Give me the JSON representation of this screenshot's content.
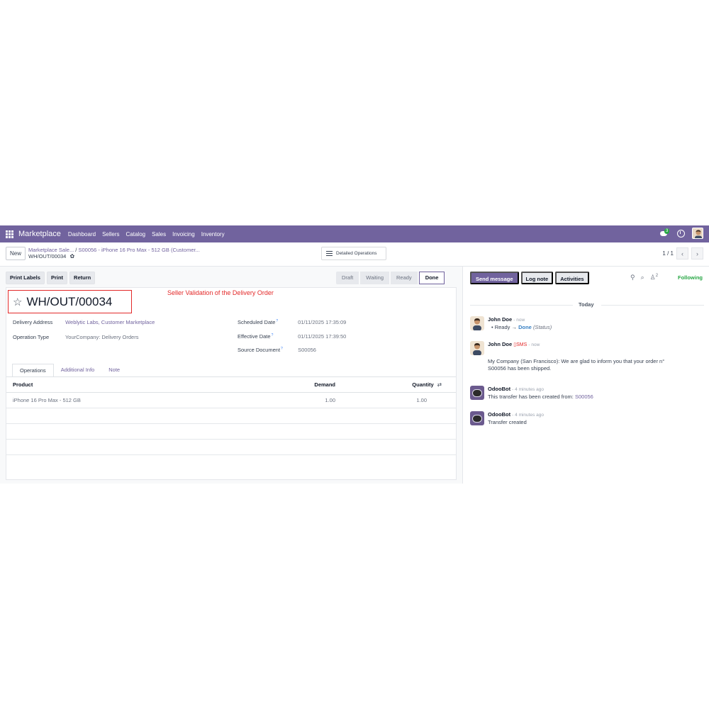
{
  "navbar": {
    "app_name": "Marketplace",
    "menu": [
      "Dashboard",
      "Sellers",
      "Catalog",
      "Sales",
      "Invoicing",
      "Inventory"
    ],
    "chat_badge": "3"
  },
  "control": {
    "new_label": "New",
    "breadcrumb_parent": "Marketplace Sale...",
    "breadcrumb_sep": "/",
    "breadcrumb_order": "S00056 - iPhone 16 Pro Max - 512 GB (Customer...",
    "breadcrumb_current": "WH/OUT/00034",
    "detailed_operations": "Detailed Operations",
    "pager": "1 / 1"
  },
  "actions": [
    "Print Labels",
    "Print",
    "Return"
  ],
  "statusbar": {
    "stages": [
      "Draft",
      "Waiting",
      "Ready",
      "Done"
    ],
    "current": "Done"
  },
  "form": {
    "title": "WH/OUT/00034",
    "annotation": "Seller Validation of the Delivery Order",
    "delivery_address_label": "Delivery Address",
    "delivery_address": "Weblytic Labs, Customer Marketplace",
    "operation_type_label": "Operation Type",
    "operation_type": "YourCompany: Delivery Orders",
    "scheduled_date_label": "Scheduled Date",
    "scheduled_date": "01/11/2025 17:35:09",
    "effective_date_label": "Effective Date",
    "effective_date": "01/11/2025 17:39:50",
    "source_document_label": "Source Document",
    "source_document": "S00056",
    "help_mark": "?"
  },
  "tabs": [
    "Operations",
    "Additional Info",
    "Note"
  ],
  "operations": {
    "headers": {
      "product": "Product",
      "demand": "Demand",
      "quantity": "Quantity"
    },
    "rows": [
      {
        "product": "iPhone 16 Pro Max - 512 GB",
        "demand": "1.00",
        "quantity": "1.00"
      }
    ]
  },
  "chatter": {
    "send_message": "Send message",
    "log_note": "Log note",
    "activities": "Activities",
    "followers_count": "2",
    "following": "Following",
    "date_separator": "Today",
    "messages": [
      {
        "author": "John Doe",
        "time": "- now",
        "old_value": "Ready",
        "arrow": "→",
        "new_value": "Done",
        "field": "(Status)"
      },
      {
        "author": "John Doe",
        "sms": "▯SMS",
        "time": "- now",
        "body": "My Company (San Francisco): We are glad to inform you that your order n° S00056 has been shipped."
      },
      {
        "author": "OdooBot",
        "time": "- 4 minutes ago",
        "body": "This transfer has been created from:",
        "link": "S00056"
      },
      {
        "author": "OdooBot",
        "time": "- 4 minutes ago",
        "body": "Transfer created"
      }
    ]
  },
  "colors": {
    "brand": "#71639e",
    "annotation": "#e32929",
    "following": "#28a745"
  }
}
